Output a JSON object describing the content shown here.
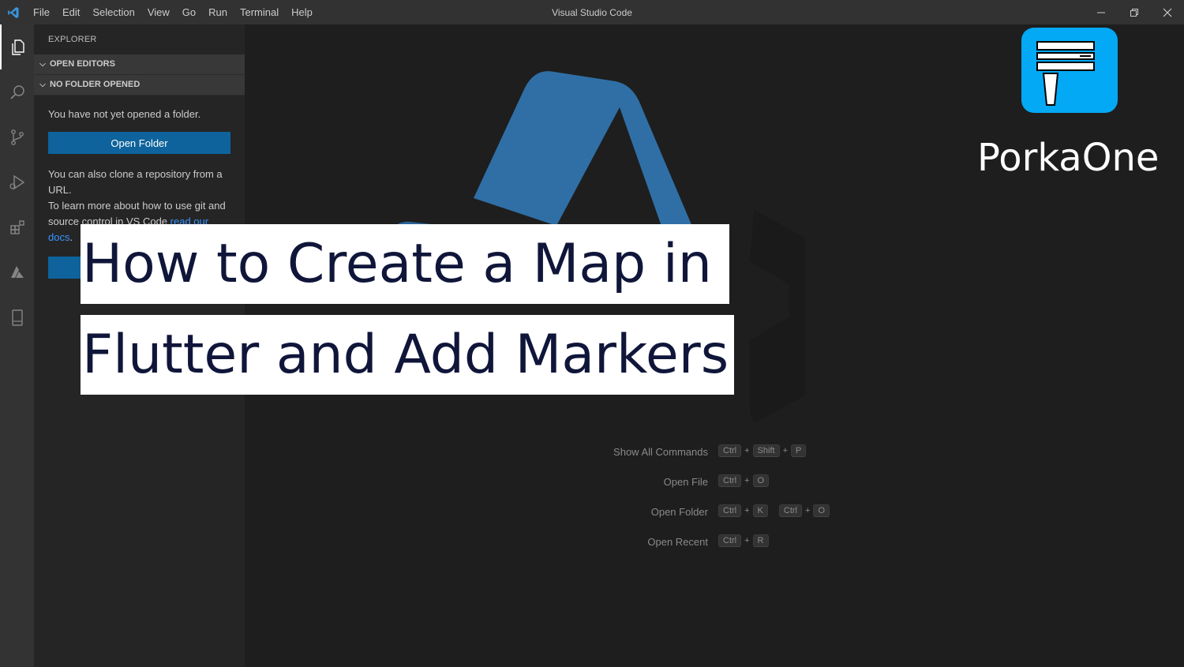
{
  "titlebar": {
    "menu": [
      "File",
      "Edit",
      "Selection",
      "View",
      "Go",
      "Run",
      "Terminal",
      "Help"
    ],
    "title": "Visual Studio Code",
    "controls": [
      "minimize-icon",
      "restore-icon",
      "close-icon"
    ]
  },
  "activitybar": {
    "icons": [
      "files-icon",
      "search-icon",
      "source-control-icon",
      "run-debug-icon",
      "extensions-icon",
      "azure-icon",
      "device-icon"
    ]
  },
  "sidebar": {
    "header": "EXPLORER",
    "sections": [
      "OPEN EDITORS",
      "NO FOLDER OPENED"
    ],
    "no_folder_text": "You have not yet opened a folder.",
    "open_folder_button": "Open Folder",
    "clone_text_1": "You can also clone a repository from a URL.",
    "clone_text_2": "To learn more about how to use git and",
    "clone_text_3": "source control in VS Code",
    "docs_link": "read our docs",
    "period": "."
  },
  "shortcuts": [
    {
      "label": "Show All Commands",
      "keys": [
        "Ctrl",
        "+",
        "Shift",
        "+",
        "P"
      ]
    },
    {
      "label": "Open File",
      "keys": [
        "Ctrl",
        "+",
        "O"
      ]
    },
    {
      "label": "Open Folder",
      "keys": [
        "Ctrl",
        "+",
        "K",
        " ",
        "Ctrl",
        "+",
        "O"
      ]
    },
    {
      "label": "Open Recent",
      "keys": [
        "Ctrl",
        "+",
        "R"
      ]
    }
  ],
  "overlay": {
    "line1": "How to Create a Map in",
    "line2": "Flutter and Add Markers"
  },
  "brand": {
    "name": "PorkaOne",
    "color": "#03a9f4"
  },
  "colors": {
    "accent_button": "#0e639c",
    "link": "#3794ff",
    "logo_blue": "#2f6fa6"
  }
}
